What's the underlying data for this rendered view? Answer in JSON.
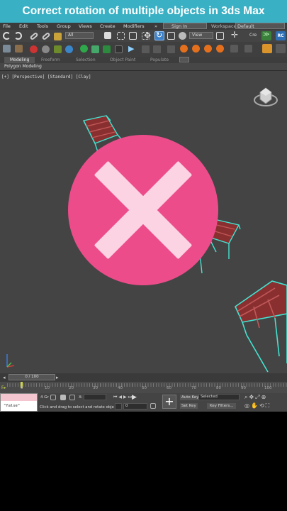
{
  "banner": {
    "title": "Correct rotation of multiple objects in 3ds Max"
  },
  "menu": [
    "File",
    "Edit",
    "Tools",
    "Group",
    "Views",
    "Create",
    "Modifiers"
  ],
  "menu_overflow": "»",
  "sign_in": "Sign In",
  "workspaces_label": "Workspaces:",
  "workspaces_value": "Default",
  "selection_filter": "All",
  "view_dropdown": "View",
  "coord_label": "Cre",
  "rc_badge": "RC",
  "ribbon_tabs": [
    "Modeling",
    "Freeform",
    "Selection",
    "Object Paint",
    "Populate"
  ],
  "ribbon_sub": "Polygon Modeling",
  "viewport_label": "[+] [Perspective] [Standard] [Clay]",
  "time_slider": "0 / 100",
  "track_ticks": [
    "0",
    "10",
    "20",
    "30",
    "40",
    "50",
    "60",
    "70",
    "80",
    "90",
    "100"
  ],
  "status": {
    "script_text": "\"false\"",
    "prompt": "Click and drag to select and rotate obje",
    "x_label": "X:",
    "grid_label": "4 Gr",
    "auto_key": "Auto Key",
    "selected": "Selected",
    "set_key": "Set Key",
    "key_filters": "Key Filters...",
    "frame": "0"
  },
  "colors": {
    "accent_banner": "#3ab0c4",
    "overlay": "#ed4c8b",
    "x_mark": "#fbd3e3",
    "chair_outline": "#43e3d1"
  }
}
